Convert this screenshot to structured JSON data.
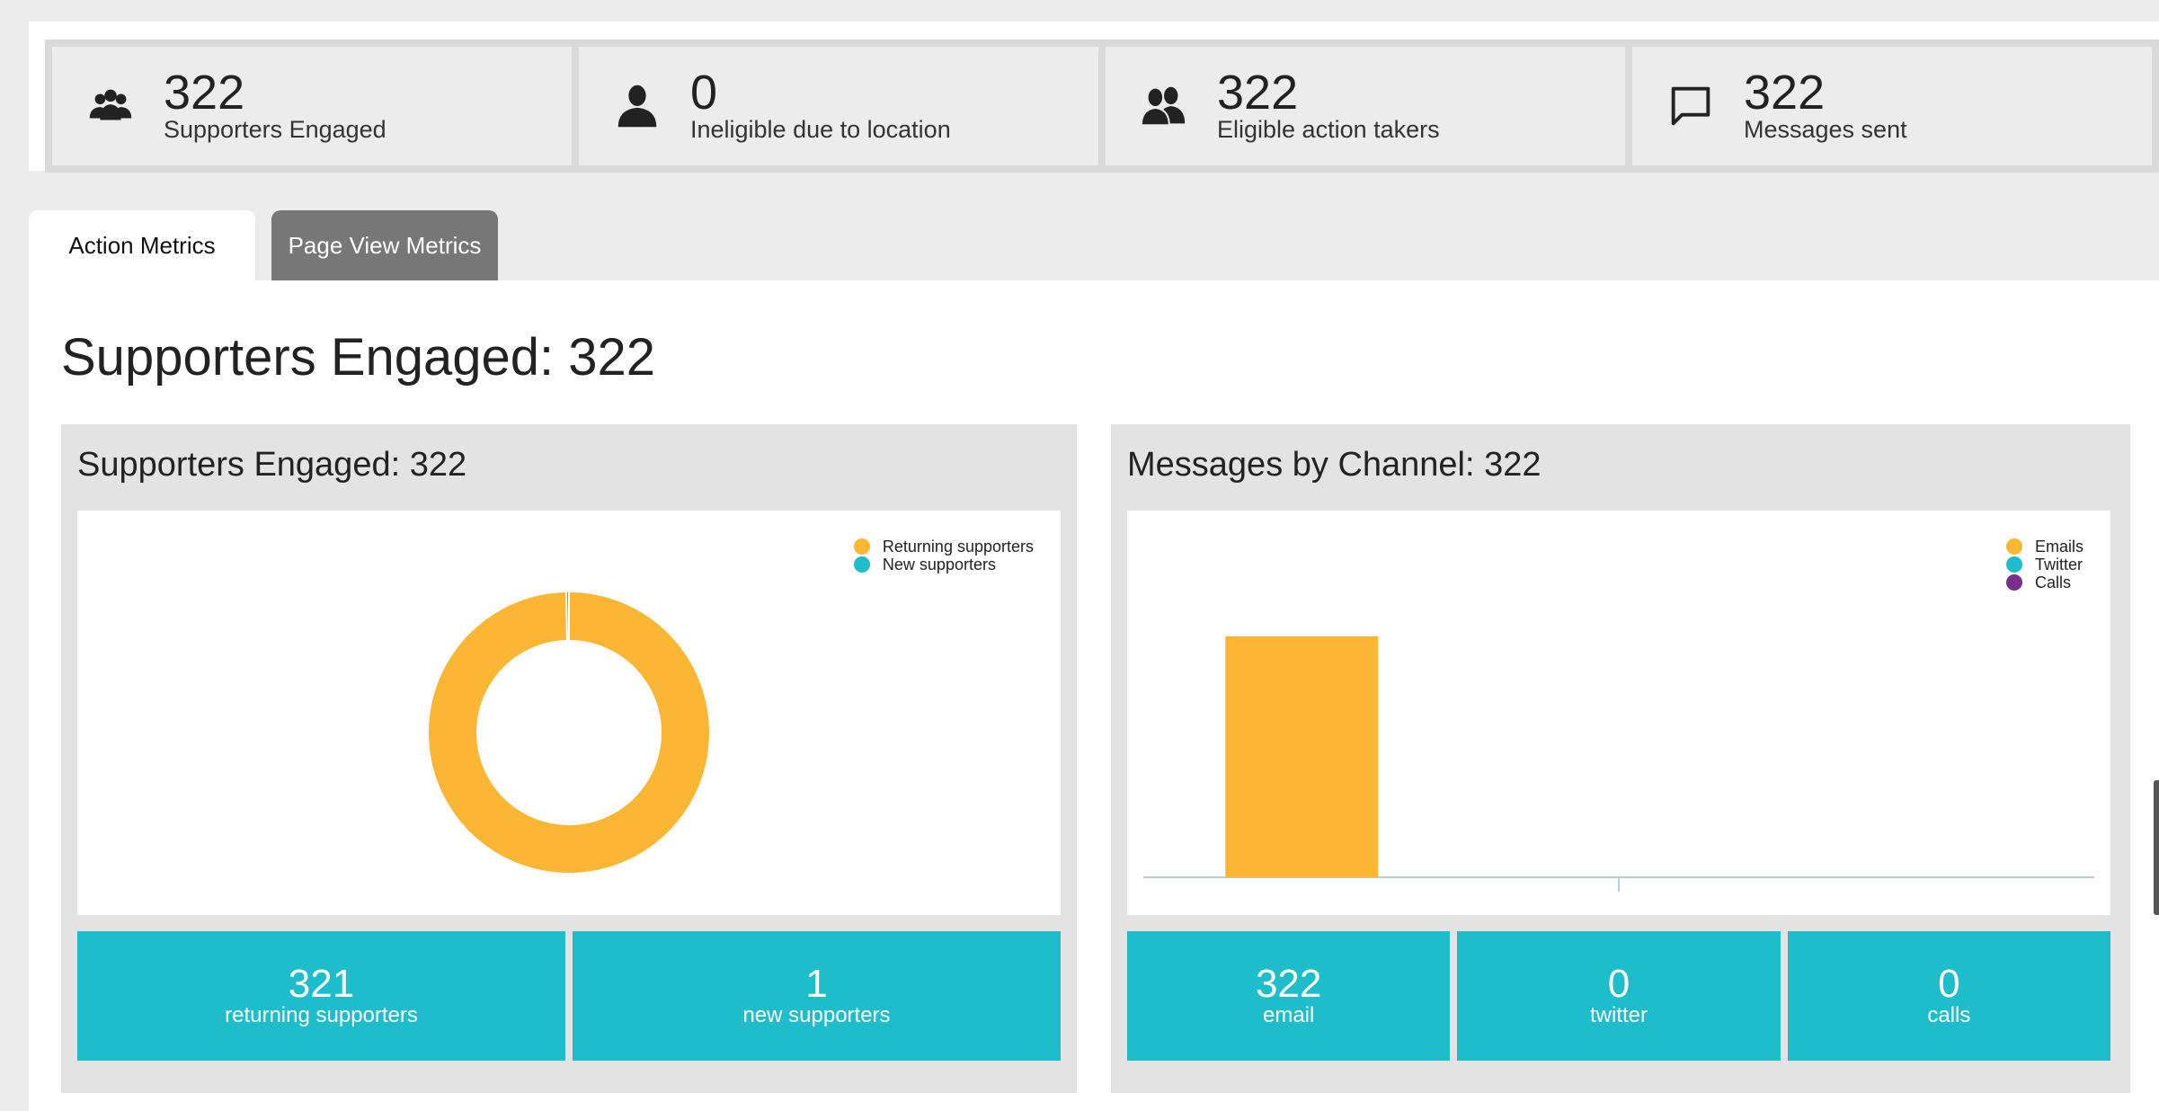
{
  "stats": [
    {
      "value": "322",
      "label": "Supporters Engaged",
      "icon": "group-icon"
    },
    {
      "value": "0",
      "label": "Ineligible due to location",
      "icon": "person-icon"
    },
    {
      "value": "322",
      "label": "Eligible action takers",
      "icon": "pair-icon"
    },
    {
      "value": "322",
      "label": "Messages sent",
      "icon": "chat-bubble-icon"
    }
  ],
  "tabs": [
    {
      "label": "Action Metrics",
      "active": true
    },
    {
      "label": "Page View Metrics",
      "active": false
    }
  ],
  "page_title": "Supporters Engaged: 322",
  "colors": {
    "orange": "#fbb634",
    "teal": "#1ebdcc",
    "purple": "#7b2f8c",
    "tab_inactive": "#777777"
  },
  "left_panel": {
    "title": "Supporters Engaged: 322",
    "legend": [
      {
        "label": "Returning supporters",
        "color": "#fbb634"
      },
      {
        "label": "New supporters",
        "color": "#1ebdcc"
      }
    ],
    "tiles": [
      {
        "value": "321",
        "label": "returning supporters"
      },
      {
        "value": "1",
        "label": "new supporters"
      }
    ]
  },
  "right_panel": {
    "title": "Messages by Channel: 322",
    "legend": [
      {
        "label": "Emails",
        "color": "#fbb634"
      },
      {
        "label": "Twitter",
        "color": "#1ebdcc"
      },
      {
        "label": "Calls",
        "color": "#7b2f8c"
      }
    ],
    "tiles": [
      {
        "value": "322",
        "label": "email"
      },
      {
        "value": "0",
        "label": "twitter"
      },
      {
        "value": "0",
        "label": "calls"
      }
    ]
  },
  "chart_data": [
    {
      "type": "pie",
      "labels": [
        "Returning supporters",
        "New supporters"
      ],
      "values": [
        321,
        1
      ],
      "colors": [
        "#fbb634",
        "#1ebdcc"
      ],
      "title": "Supporters Engaged: 322",
      "legend": "top-right"
    },
    {
      "type": "bar",
      "categories": [
        "Emails",
        "Twitter",
        "Calls"
      ],
      "values": [
        322,
        0,
        0
      ],
      "colors": [
        "#fbb634",
        "#1ebdcc",
        "#7b2f8c"
      ],
      "title": "Messages by Channel: 322",
      "legend": "top-right",
      "ylim": [
        0,
        490
      ]
    }
  ]
}
